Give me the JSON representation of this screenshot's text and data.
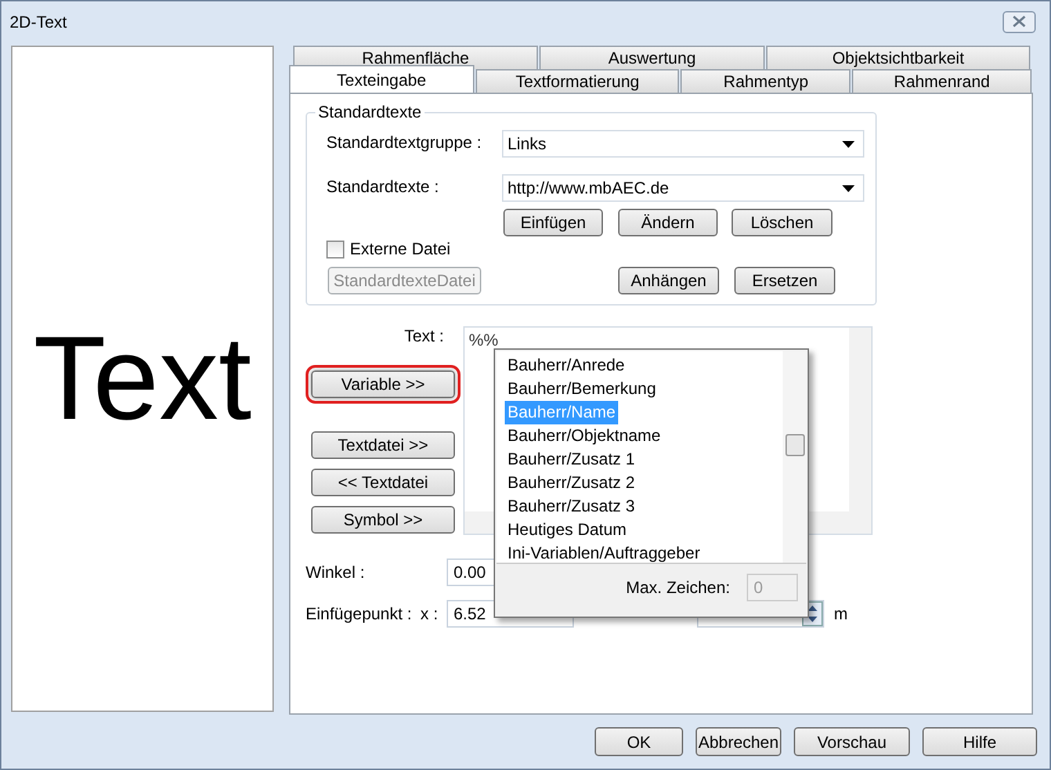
{
  "window": {
    "title": "2D-Text"
  },
  "preview": {
    "text": "Text"
  },
  "tab_rows": [
    [
      {
        "label": "Rahmenfläche",
        "selected": false
      },
      {
        "label": "Auswertung",
        "selected": false
      },
      {
        "label": "Objektsichtbarkeit",
        "selected": false
      }
    ],
    [
      {
        "label": "Texteingabe",
        "selected": true
      },
      {
        "label": "Textformatierung",
        "selected": false
      },
      {
        "label": "Rahmentyp",
        "selected": false
      },
      {
        "label": "Rahmenrand",
        "selected": false
      }
    ]
  ],
  "standardtexte": {
    "legend": "Standardtexte",
    "group_label": "Standardtextgruppe :",
    "group_value": "Links",
    "text_label": "Standardtexte :",
    "text_value": "http://www.mbAEC.de",
    "buttons_row1": [
      {
        "label": "Einfügen",
        "disabled": false
      },
      {
        "label": "Ändern",
        "disabled": false
      },
      {
        "label": "Löschen",
        "disabled": false
      }
    ],
    "external_file": {
      "label": "Externe Datei",
      "checked": false
    },
    "file_button": {
      "label": "StandardtexteDatei",
      "disabled": true
    },
    "buttons_row2": [
      {
        "label": "Anhängen",
        "disabled": false
      },
      {
        "label": "Ersetzen",
        "disabled": false
      }
    ]
  },
  "text_input": {
    "label": "Text :",
    "value": "%%"
  },
  "side_buttons": [
    {
      "label": "Variable >>",
      "highlighted": true
    },
    {
      "label": "Textdatei >>",
      "highlighted": false
    },
    {
      "label": "<< Textdatei",
      "highlighted": false
    },
    {
      "label": "Symbol >>",
      "highlighted": false
    }
  ],
  "variable_popup": {
    "items": [
      {
        "label": "Bauherr/Anrede",
        "selected": false
      },
      {
        "label": "Bauherr/Bemerkung",
        "selected": false
      },
      {
        "label": "Bauherr/Name",
        "selected": true
      },
      {
        "label": "Bauherr/Objektname",
        "selected": false
      },
      {
        "label": "Bauherr/Zusatz 1",
        "selected": false
      },
      {
        "label": "Bauherr/Zusatz 2",
        "selected": false
      },
      {
        "label": "Bauherr/Zusatz 3",
        "selected": false
      },
      {
        "label": "Heutiges Datum",
        "selected": false
      },
      {
        "label": "Ini-Variablen/Auftraggeber",
        "selected": false
      }
    ],
    "max_label": "Max. Zeichen:",
    "max_value": "0",
    "max_disabled": true
  },
  "winkel": {
    "label": "Winkel :",
    "value": "0.00"
  },
  "einfuegepunkt": {
    "label": "Einfügepunkt :",
    "x_label": "x :",
    "x_value": "6.52",
    "unit": "m"
  },
  "footer_buttons": [
    "OK",
    "Abbrechen",
    "Vorschau",
    "Hilfe"
  ]
}
